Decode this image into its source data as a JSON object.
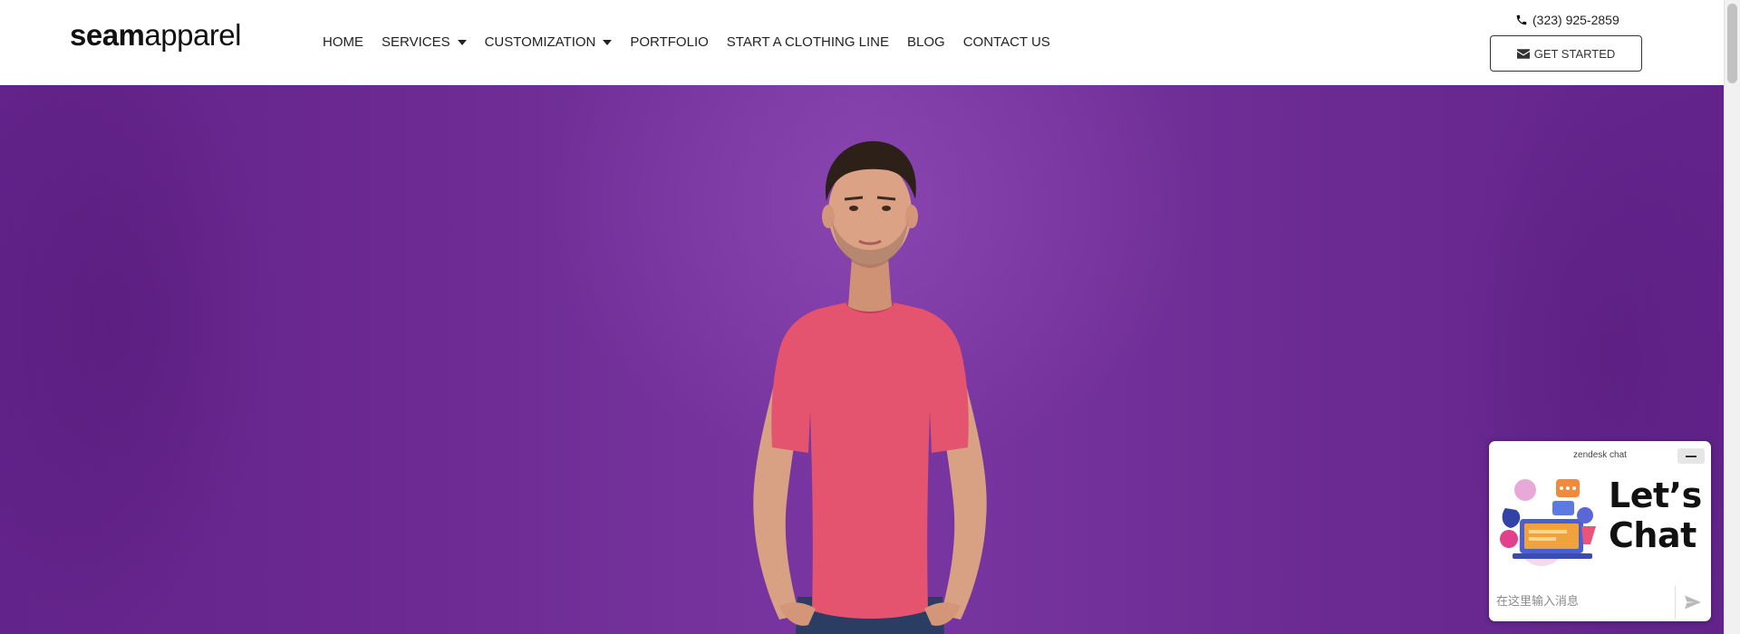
{
  "logo": {
    "bold": "seam",
    "light": "apparel"
  },
  "nav": {
    "items": [
      {
        "label": "HOME"
      },
      {
        "label": "SERVICES"
      },
      {
        "label": "CUSTOMIZATION"
      },
      {
        "label": "PORTFOLIO"
      },
      {
        "label": "START A CLOTHING LINE"
      },
      {
        "label": "BLOG"
      },
      {
        "label": "CONTACT US"
      }
    ]
  },
  "contact": {
    "phone": "(323) 925-2859",
    "cta_label": "GET STARTED"
  },
  "chat": {
    "title": "zendesk chat",
    "heading_line1": "Let’s",
    "heading_line2": "Chat",
    "input_placeholder": "在这里输入消息"
  },
  "colors": {
    "hero_purple": "#6f2d98",
    "shirt_pink": "#e4546e",
    "text_dark": "#222222"
  },
  "icons": [
    "phone-icon",
    "mail-icon",
    "caret-down-icon",
    "minimize-icon",
    "send-icon"
  ]
}
